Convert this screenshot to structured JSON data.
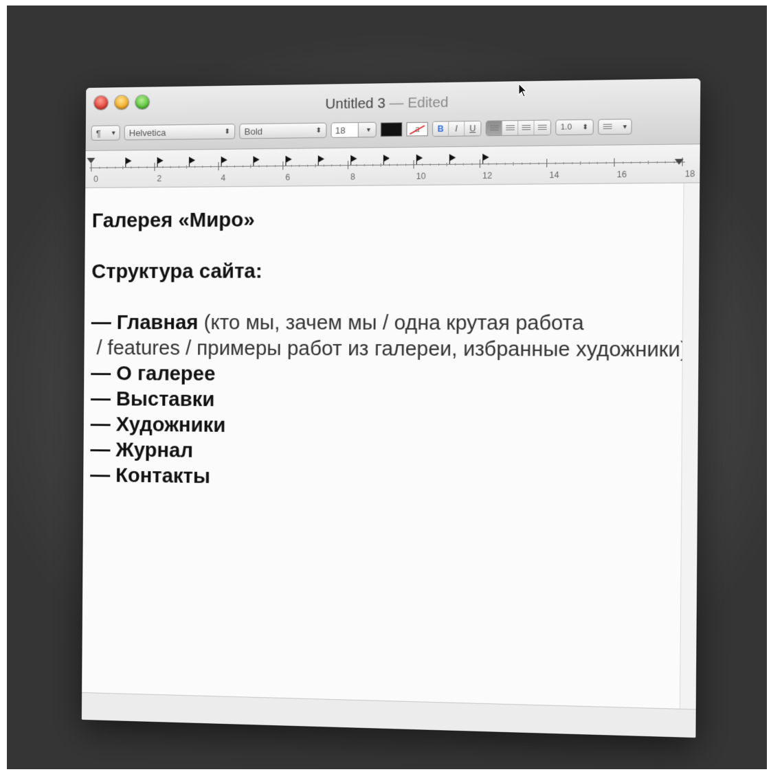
{
  "window": {
    "title": "Untitled 3",
    "title_separator": "—",
    "title_status": "Edited"
  },
  "toolbar": {
    "paragraph_label": "¶",
    "font_family": "Helvetica",
    "font_style": "Bold",
    "font_size": "18",
    "dropdown_glyph": "▾",
    "stepper_glyph": "⬍",
    "highlight_glyph": "a",
    "bold_label": "B",
    "italic_label": "I",
    "underline_label": "U",
    "spacing_label": "1.0",
    "text_color": "#111111"
  },
  "ruler": {
    "labels": [
      "0",
      "2",
      "4",
      "6",
      "8",
      "10",
      "12",
      "14",
      "16",
      "18"
    ]
  },
  "document": {
    "heading": "Галерея «Миро»",
    "subheading": "Структура сайта:",
    "items": [
      {
        "dash": "—",
        "title": "Главная",
        "detail": " (кто мы, зачем мы / одна крутая работа"
      },
      {
        "continuation": "/ features / примеры работ из галереи, избранные художники)"
      },
      {
        "dash": "—",
        "title": "О галерее"
      },
      {
        "dash": "—",
        "title": "Выставки"
      },
      {
        "dash": "—",
        "title": "Художники"
      },
      {
        "dash": "—",
        "title": "Журнал"
      },
      {
        "dash": "—",
        "title": "Контакты"
      }
    ]
  }
}
